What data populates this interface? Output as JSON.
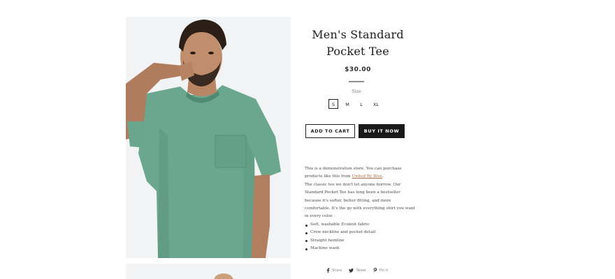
{
  "product": {
    "title_line1": "Men's Standard",
    "title_line2": "Pocket Tee",
    "price": "$30.00",
    "size_label": "Size",
    "sizes": [
      "S",
      "M",
      "L",
      "XL"
    ],
    "selected_size": "S"
  },
  "actions": {
    "add_to_cart": "ADD TO CART",
    "buy_now": "BUY IT NOW"
  },
  "description": {
    "intro_before_link": "This is a demonstration store. You can purchase products like this from ",
    "link_text": "United By Blue",
    "intro_after_link": ".",
    "body": "The classic tee we don't let anyone borrow. Our Standard Pocket Tee has long been a bestseller because it's softer, better fitting, and more comfortable. It's the go with everything shirt you want in every color.",
    "bullets": [
      "Soft, washable Ecoknit fabric",
      "Crew neckline and pocket detail",
      "Straight hemline",
      "Machine wash"
    ]
  },
  "share": {
    "facebook": "Share",
    "twitter": "Tweet",
    "pinterest": "Pin it"
  },
  "colors": {
    "shirt": "#6aa58d",
    "button_dark": "#1a1a1a",
    "link": "#b0704a"
  },
  "icons": {
    "facebook": "facebook-icon",
    "twitter": "twitter-icon",
    "pinterest": "pinterest-icon"
  }
}
